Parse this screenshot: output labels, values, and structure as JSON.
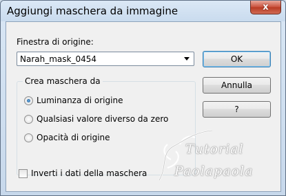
{
  "window": {
    "title": "Aggiungi maschera da immagine",
    "close_label": "x"
  },
  "source": {
    "label": "Finestra di origine:",
    "selected": "Narah_mask_0454"
  },
  "buttons": {
    "ok": "OK",
    "cancel": "Annulla",
    "help": "?"
  },
  "mask_group": {
    "legend": "Crea maschera da",
    "options": [
      {
        "label": "Luminanza di origine",
        "checked": true
      },
      {
        "label": "Qualsiasi valore diverso da zero",
        "checked": false
      },
      {
        "label": "Opacità di origine",
        "checked": false
      }
    ]
  },
  "invert": {
    "label": "Inverti i dati della maschera",
    "checked": false
  },
  "watermark": {
    "line1": "Tutorial",
    "line2": "Paolapaola"
  }
}
